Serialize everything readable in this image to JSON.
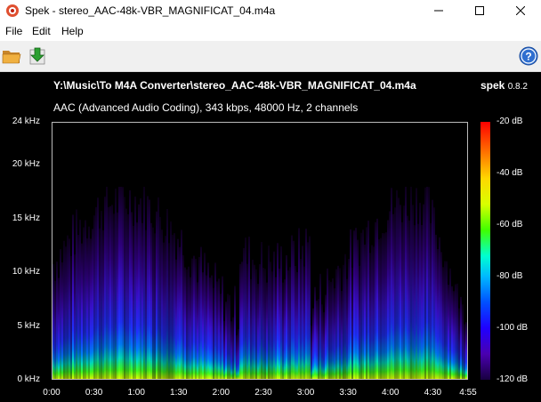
{
  "window": {
    "title": "Spek - stereo_AAC-48k-VBR_MAGNIFICAT_04.m4a",
    "minimize_icon": "minimize-icon",
    "maximize_icon": "maximize-icon",
    "close_icon": "close-icon"
  },
  "menu": [
    "File",
    "Edit",
    "Help"
  ],
  "toolbar": {
    "open_icon": "folder-open-icon",
    "save_icon": "save-icon",
    "help_icon": "help-icon"
  },
  "spectrogram": {
    "file_path": "Y:\\Music\\To M4A Converter\\stereo_AAC-48k-VBR_MAGNIFICAT_04.m4a",
    "brand_name": "spek",
    "brand_version": "0.8.2",
    "audio_info": "AAC (Advanced Audio Coding), 343 kbps, 48000 Hz, 2 channels",
    "y_ticks": [
      "24 kHz",
      "20 kHz",
      "15 kHz",
      "10 kHz",
      "5 kHz",
      "0 kHz"
    ],
    "x_ticks": [
      "0:00",
      "0:30",
      "1:00",
      "1:30",
      "2:00",
      "2:30",
      "3:00",
      "3:30",
      "4:00",
      "4:30",
      "4:55"
    ],
    "color_scale_ticks": [
      "-20 dB",
      "-40 dB",
      "-60 dB",
      "-80 dB",
      "-100 dB",
      "-120 dB"
    ],
    "frequency_max_khz": 24,
    "duration_seconds": 295,
    "db_range": [
      -120,
      -20
    ]
  }
}
